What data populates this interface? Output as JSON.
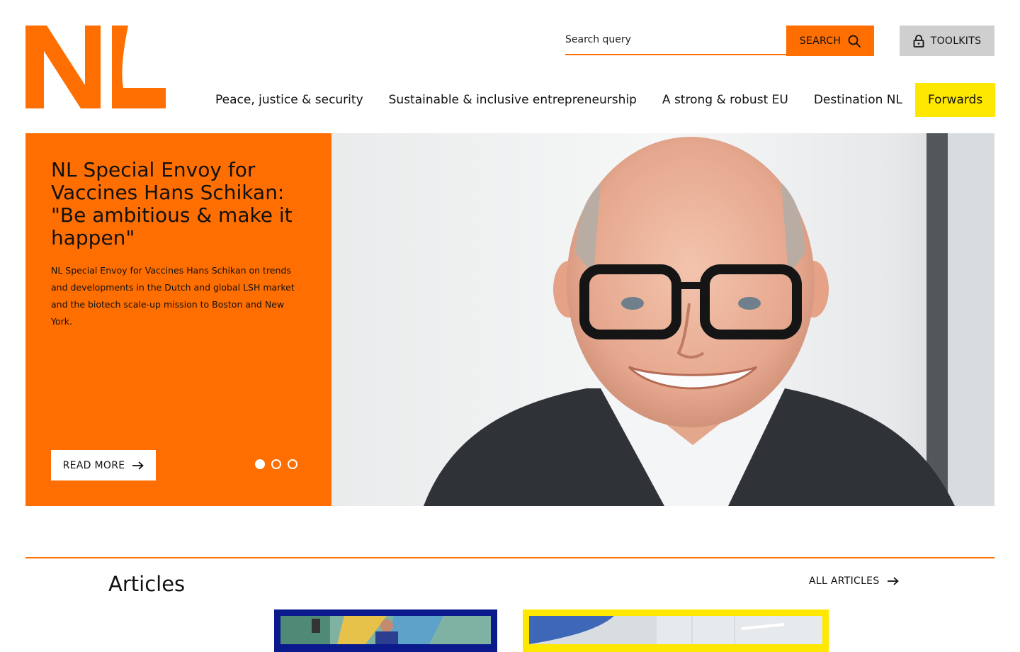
{
  "header": {
    "logo_text": "NL",
    "search": {
      "placeholder": "Search query",
      "button_label": "SEARCH"
    },
    "toolkits_label": "TOOLKITS"
  },
  "nav": {
    "items": [
      {
        "label": "Peace, justice & security"
      },
      {
        "label": "Sustainable & inclusive entrepreneurship"
      },
      {
        "label": "A strong & robust EU"
      },
      {
        "label": "Destination NL"
      },
      {
        "label": "Forwards",
        "active": true
      }
    ]
  },
  "hero": {
    "title": "NL Special Envoy for Vaccines Hans Schikan: \"Be ambitious & make it happen\"",
    "text": "NL Special Envoy for Vaccines Hans Schikan on trends and developments in the Dutch and global LSH market and the biotech scale-up mission to Boston and New York.",
    "read_more_label": "READ MORE",
    "slides_total": 3,
    "active_slide": 1
  },
  "articles": {
    "heading": "Articles",
    "all_label": "ALL ARTICLES"
  },
  "colors": {
    "brand_orange": "#ff6e00",
    "highlight_yellow": "#ffe800",
    "card_navy": "#0a1a8c",
    "toolkits_gray": "#cfcfcf"
  }
}
